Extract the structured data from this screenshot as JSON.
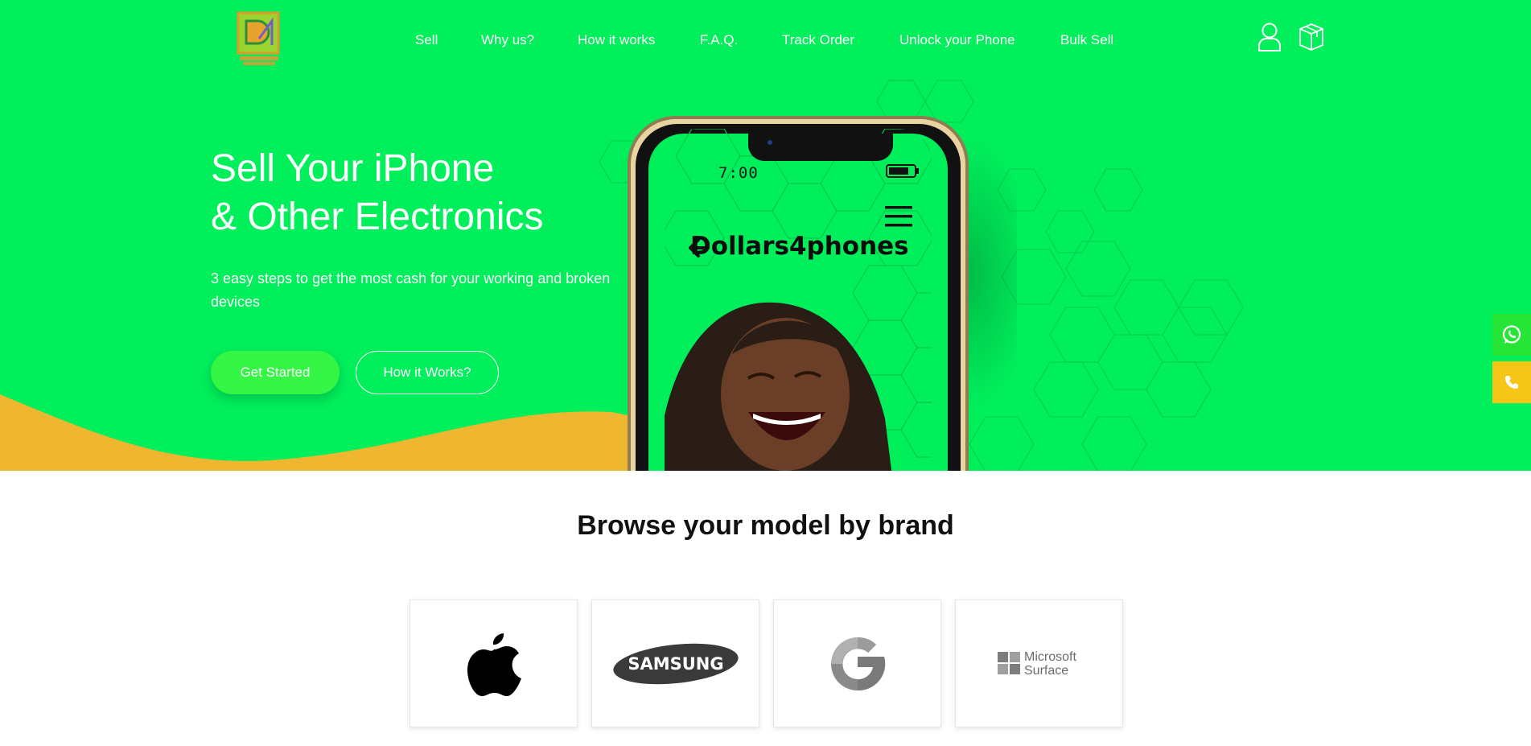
{
  "nav": {
    "items": [
      {
        "label": "Sell"
      },
      {
        "label": "Why us?"
      },
      {
        "label": "How it works"
      },
      {
        "label": "F.A.Q."
      },
      {
        "label": "Track Order"
      },
      {
        "label": "Unlock your Phone"
      },
      {
        "label": "Bulk Sell"
      }
    ],
    "icons": [
      "user-icon",
      "package-icon"
    ]
  },
  "hero": {
    "title_line1": "Sell Your iPhone",
    "title_line2": "& Other Electronics",
    "subtitle": "3 easy steps to get the most cash for your working and broken devices",
    "primary_button": "Get Started",
    "secondary_button": "How it Works?",
    "phone_clock": "7:00",
    "phone_brand": "Dollars4phones"
  },
  "side_buttons": {
    "icons": [
      "whatsapp-icon",
      "phone-icon"
    ]
  },
  "browse": {
    "title": "Browse your model by brand",
    "brands": [
      {
        "name": "apple-logo"
      },
      {
        "name": "samsung-logo",
        "label": "SAMSUNG"
      },
      {
        "name": "google-logo"
      },
      {
        "name": "microsoft-surface-logo",
        "line1": "Microsoft",
        "line2": "Surface"
      }
    ]
  },
  "colors": {
    "hero_green": "#00ef5b",
    "wave_yellow": "#efb62f",
    "button_green": "#35f545",
    "whatsapp_green": "#27e537",
    "call_yellow": "#f5c518"
  }
}
